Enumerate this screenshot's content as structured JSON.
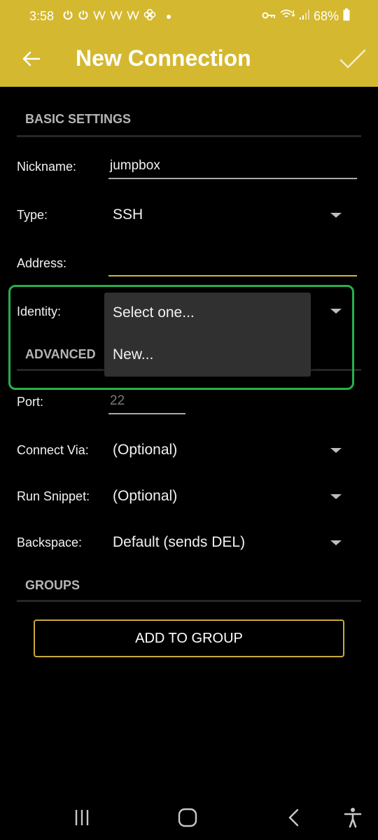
{
  "status_bar": {
    "time": "3:58",
    "left_icons": [
      "power-icon",
      "power-icon",
      "w-app-icon",
      "w-app-icon",
      "w-app-icon",
      "fan-icon",
      "dot-icon"
    ],
    "right_icons": [
      "vpn-key-icon",
      "wifi-icon",
      "signal-icon",
      "battery-icon"
    ],
    "battery": "68%"
  },
  "app_bar": {
    "title": "New Connection",
    "back_icon": "arrow-left-icon",
    "confirm_icon": "check-icon",
    "color": "#d4b830"
  },
  "basic_settings": {
    "header": "BASIC SETTINGS",
    "nickname": {
      "label": "Nickname:",
      "value": "jumpbox"
    },
    "type": {
      "label": "Type:",
      "value": "SSH"
    },
    "address": {
      "label": "Address:",
      "value": ""
    },
    "identity": {
      "label": "Identity:",
      "value": "Select one..."
    }
  },
  "identity_dropdown": {
    "options": [
      "Select one...",
      "New..."
    ]
  },
  "advanced": {
    "header": "ADVANCED",
    "port": {
      "label": "Port:",
      "placeholder": "22"
    },
    "connect_via": {
      "label": "Connect Via:",
      "value": "(Optional)"
    },
    "run_snippet": {
      "label": "Run Snippet:",
      "value": "(Optional)"
    },
    "backspace": {
      "label": "Backspace:",
      "value": "Default (sends DEL)"
    }
  },
  "groups": {
    "header": "GROUPS",
    "add_button": "ADD TO GROUP"
  },
  "nav_bar": {
    "icons": [
      "recent-apps-icon",
      "home-icon",
      "back-icon",
      "accessibility-icon"
    ]
  }
}
